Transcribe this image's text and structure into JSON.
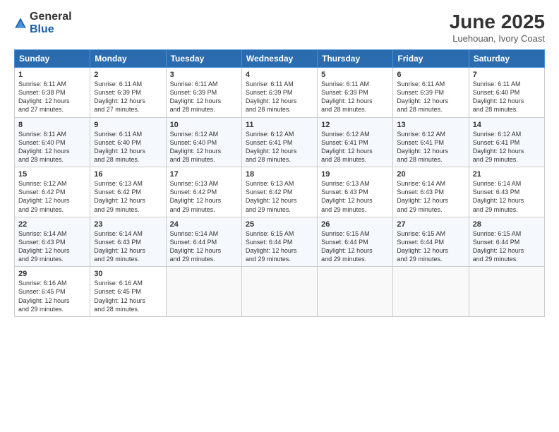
{
  "logo": {
    "general": "General",
    "blue": "Blue"
  },
  "title": "June 2025",
  "subtitle": "Luehouan, Ivory Coast",
  "headers": [
    "Sunday",
    "Monday",
    "Tuesday",
    "Wednesday",
    "Thursday",
    "Friday",
    "Saturday"
  ],
  "weeks": [
    [
      {
        "day": "1",
        "sunrise": "6:11 AM",
        "sunset": "6:38 PM",
        "daylight": "12 hours and 27 minutes."
      },
      {
        "day": "2",
        "sunrise": "6:11 AM",
        "sunset": "6:39 PM",
        "daylight": "12 hours and 27 minutes."
      },
      {
        "day": "3",
        "sunrise": "6:11 AM",
        "sunset": "6:39 PM",
        "daylight": "12 hours and 28 minutes."
      },
      {
        "day": "4",
        "sunrise": "6:11 AM",
        "sunset": "6:39 PM",
        "daylight": "12 hours and 28 minutes."
      },
      {
        "day": "5",
        "sunrise": "6:11 AM",
        "sunset": "6:39 PM",
        "daylight": "12 hours and 28 minutes."
      },
      {
        "day": "6",
        "sunrise": "6:11 AM",
        "sunset": "6:39 PM",
        "daylight": "12 hours and 28 minutes."
      },
      {
        "day": "7",
        "sunrise": "6:11 AM",
        "sunset": "6:40 PM",
        "daylight": "12 hours and 28 minutes."
      }
    ],
    [
      {
        "day": "8",
        "sunrise": "6:11 AM",
        "sunset": "6:40 PM",
        "daylight": "12 hours and 28 minutes."
      },
      {
        "day": "9",
        "sunrise": "6:11 AM",
        "sunset": "6:40 PM",
        "daylight": "12 hours and 28 minutes."
      },
      {
        "day": "10",
        "sunrise": "6:12 AM",
        "sunset": "6:40 PM",
        "daylight": "12 hours and 28 minutes."
      },
      {
        "day": "11",
        "sunrise": "6:12 AM",
        "sunset": "6:41 PM",
        "daylight": "12 hours and 28 minutes."
      },
      {
        "day": "12",
        "sunrise": "6:12 AM",
        "sunset": "6:41 PM",
        "daylight": "12 hours and 28 minutes."
      },
      {
        "day": "13",
        "sunrise": "6:12 AM",
        "sunset": "6:41 PM",
        "daylight": "12 hours and 28 minutes."
      },
      {
        "day": "14",
        "sunrise": "6:12 AM",
        "sunset": "6:41 PM",
        "daylight": "12 hours and 29 minutes."
      }
    ],
    [
      {
        "day": "15",
        "sunrise": "6:12 AM",
        "sunset": "6:42 PM",
        "daylight": "12 hours and 29 minutes."
      },
      {
        "day": "16",
        "sunrise": "6:13 AM",
        "sunset": "6:42 PM",
        "daylight": "12 hours and 29 minutes."
      },
      {
        "day": "17",
        "sunrise": "6:13 AM",
        "sunset": "6:42 PM",
        "daylight": "12 hours and 29 minutes."
      },
      {
        "day": "18",
        "sunrise": "6:13 AM",
        "sunset": "6:42 PM",
        "daylight": "12 hours and 29 minutes."
      },
      {
        "day": "19",
        "sunrise": "6:13 AM",
        "sunset": "6:43 PM",
        "daylight": "12 hours and 29 minutes."
      },
      {
        "day": "20",
        "sunrise": "6:14 AM",
        "sunset": "6:43 PM",
        "daylight": "12 hours and 29 minutes."
      },
      {
        "day": "21",
        "sunrise": "6:14 AM",
        "sunset": "6:43 PM",
        "daylight": "12 hours and 29 minutes."
      }
    ],
    [
      {
        "day": "22",
        "sunrise": "6:14 AM",
        "sunset": "6:43 PM",
        "daylight": "12 hours and 29 minutes."
      },
      {
        "day": "23",
        "sunrise": "6:14 AM",
        "sunset": "6:43 PM",
        "daylight": "12 hours and 29 minutes."
      },
      {
        "day": "24",
        "sunrise": "6:14 AM",
        "sunset": "6:44 PM",
        "daylight": "12 hours and 29 minutes."
      },
      {
        "day": "25",
        "sunrise": "6:15 AM",
        "sunset": "6:44 PM",
        "daylight": "12 hours and 29 minutes."
      },
      {
        "day": "26",
        "sunrise": "6:15 AM",
        "sunset": "6:44 PM",
        "daylight": "12 hours and 29 minutes."
      },
      {
        "day": "27",
        "sunrise": "6:15 AM",
        "sunset": "6:44 PM",
        "daylight": "12 hours and 29 minutes."
      },
      {
        "day": "28",
        "sunrise": "6:15 AM",
        "sunset": "6:44 PM",
        "daylight": "12 hours and 29 minutes."
      }
    ],
    [
      {
        "day": "29",
        "sunrise": "6:16 AM",
        "sunset": "6:45 PM",
        "daylight": "12 hours and 29 minutes."
      },
      {
        "day": "30",
        "sunrise": "6:16 AM",
        "sunset": "6:45 PM",
        "daylight": "12 hours and 28 minutes."
      },
      null,
      null,
      null,
      null,
      null
    ]
  ]
}
